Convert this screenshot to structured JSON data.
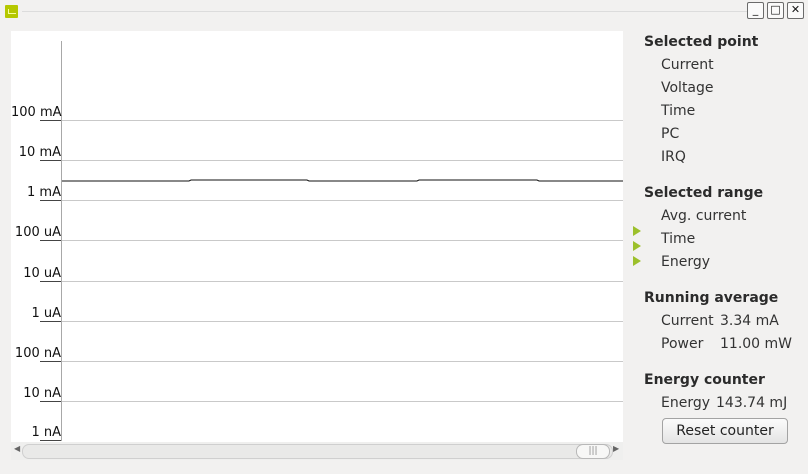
{
  "window": {
    "close_glyph": "✕",
    "maximize_glyph": "□",
    "minimize_glyph": "_"
  },
  "plot": {
    "y_labels": [
      "100 mA",
      "10 mA",
      "1 mA",
      "100 uA",
      "10 uA",
      "1 uA",
      "100 nA",
      "10 nA",
      "1 nA"
    ]
  },
  "panel": {
    "selected_point": {
      "title": "Selected point",
      "fields": [
        "Current",
        "Voltage",
        "Time",
        "PC",
        "IRQ"
      ]
    },
    "selected_range": {
      "title": "Selected range",
      "fields": [
        "Avg. current",
        "Time",
        "Energy"
      ]
    },
    "running_average": {
      "title": "Running average",
      "current_label": "Current",
      "current_value": "3.34 mA",
      "power_label": "Power",
      "power_value": "11.00 mW"
    },
    "energy_counter": {
      "title": "Energy counter",
      "energy_label": "Energy",
      "energy_value": "143.74 mJ",
      "reset_label": "Reset counter"
    }
  },
  "scrollbar": {
    "thumb_glyph": "|||"
  }
}
